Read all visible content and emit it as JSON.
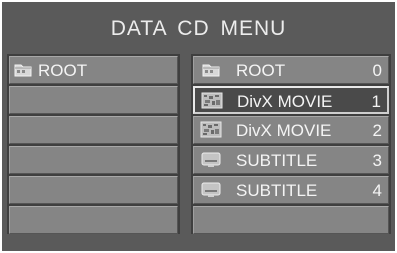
{
  "title": "DATA  CD  MENU",
  "left_panel": {
    "items": [
      {
        "label": "ROOT",
        "icon": "folder-icon"
      },
      {
        "label": ""
      },
      {
        "label": ""
      },
      {
        "label": ""
      },
      {
        "label": ""
      },
      {
        "label": ""
      }
    ]
  },
  "right_panel": {
    "items": [
      {
        "label": "ROOT",
        "number": "0",
        "icon": "folder-icon"
      },
      {
        "label": "DivX MOVIE",
        "number": "1",
        "icon": "movie-icon",
        "selected": true
      },
      {
        "label": "DivX MOVIE",
        "number": "2",
        "icon": "movie-icon"
      },
      {
        "label": "SUBTITLE",
        "number": "3",
        "icon": "subtitle-icon"
      },
      {
        "label": "SUBTITLE",
        "number": "4",
        "icon": "subtitle-icon"
      },
      {
        "label": "",
        "number": ""
      }
    ]
  }
}
